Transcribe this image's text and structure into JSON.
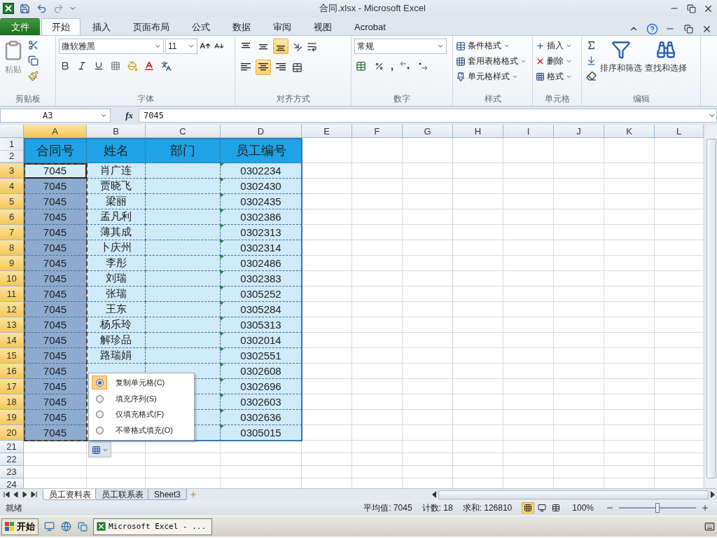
{
  "title": "合同.xlsx - Microsoft Excel",
  "ribbon_tabs": [
    {
      "label": "文件",
      "kind": "file",
      "selected": false
    },
    {
      "label": "开始",
      "kind": "tab",
      "selected": true
    },
    {
      "label": "插入",
      "kind": "tab",
      "selected": false
    },
    {
      "label": "页面布局",
      "kind": "tab",
      "selected": false
    },
    {
      "label": "公式",
      "kind": "tab",
      "selected": false
    },
    {
      "label": "数据",
      "kind": "tab",
      "selected": false
    },
    {
      "label": "审阅",
      "kind": "tab",
      "selected": false
    },
    {
      "label": "视图",
      "kind": "tab",
      "selected": false
    },
    {
      "label": "Acrobat",
      "kind": "tab",
      "selected": false
    }
  ],
  "clipboard": {
    "paste": "粘贴",
    "label": "剪贴板"
  },
  "font": {
    "name": "微软雅黑",
    "size": "11",
    "label": "字体"
  },
  "alignment": {
    "label": "对齐方式",
    "vertical": [
      {
        "selected": false
      },
      {
        "selected": false
      },
      {
        "selected": true
      }
    ],
    "horizontal": [
      {
        "selected": false
      },
      {
        "selected": true
      },
      {
        "selected": false
      }
    ]
  },
  "number": {
    "format": "常规",
    "comma": ",",
    "label": "数字"
  },
  "styles": {
    "items": [
      "条件格式",
      "套用表格格式",
      "单元格样式"
    ],
    "label": "样式"
  },
  "cells": {
    "items": [
      "插入",
      "删除",
      "格式"
    ],
    "label": "单元格"
  },
  "editing": {
    "items": [
      "排序和筛选",
      "查找和选择"
    ],
    "label": "编辑"
  },
  "formula_bar": {
    "name_box": "A3",
    "fx": "fx",
    "value": "7045"
  },
  "sheet": {
    "columns": [
      {
        "letter": "A",
        "selected": true
      },
      {
        "letter": "B",
        "selected": false
      },
      {
        "letter": "C",
        "selected": false
      },
      {
        "letter": "D",
        "selected": false
      },
      {
        "letter": "E",
        "selected": false
      },
      {
        "letter": "F",
        "selected": false
      },
      {
        "letter": "G",
        "selected": false
      },
      {
        "letter": "H",
        "selected": false
      },
      {
        "letter": "I",
        "selected": false
      },
      {
        "letter": "J",
        "selected": false
      },
      {
        "letter": "K",
        "selected": false
      },
      {
        "letter": "L",
        "selected": false
      }
    ],
    "header_rows": [
      {
        "number": "1",
        "selected": false
      },
      {
        "number": "2",
        "selected": false
      }
    ],
    "headers": [
      "合同号",
      "姓名",
      "部门",
      "员工编号"
    ],
    "id_error_flags": true,
    "rows": [
      {
        "number": "3",
        "selected": true,
        "active": true,
        "contract": "7045",
        "name": "肖广连",
        "employee_id": "0302234"
      },
      {
        "number": "4",
        "selected": true,
        "active": false,
        "contract": "7045",
        "name": "贾晓飞",
        "employee_id": "0302430"
      },
      {
        "number": "5",
        "selected": true,
        "active": false,
        "contract": "7045",
        "name": "梁丽",
        "employee_id": "0302435"
      },
      {
        "number": "6",
        "selected": true,
        "active": false,
        "contract": "7045",
        "name": "孟凡利",
        "employee_id": "0302386"
      },
      {
        "number": "7",
        "selected": true,
        "active": false,
        "contract": "7045",
        "name": "薄其成",
        "employee_id": "0302313"
      },
      {
        "number": "8",
        "selected": true,
        "active": false,
        "contract": "7045",
        "name": "卜庆州",
        "employee_id": "0302314"
      },
      {
        "number": "9",
        "selected": true,
        "active": false,
        "contract": "7045",
        "name": "李彤",
        "employee_id": "0302486"
      },
      {
        "number": "10",
        "selected": true,
        "active": false,
        "contract": "7045",
        "name": "刘瑞",
        "employee_id": "0302383"
      },
      {
        "number": "11",
        "selected": true,
        "active": false,
        "contract": "7045",
        "name": "张瑞",
        "employee_id": "0305252"
      },
      {
        "number": "12",
        "selected": true,
        "active": false,
        "contract": "7045",
        "name": "王东",
        "employee_id": "0305284"
      },
      {
        "number": "13",
        "selected": true,
        "active": false,
        "contract": "7045",
        "name": "杨乐玲",
        "employee_id": "0305313"
      },
      {
        "number": "14",
        "selected": true,
        "active": false,
        "contract": "7045",
        "name": "解珍品",
        "employee_id": "0302014"
      },
      {
        "number": "15",
        "selected": true,
        "active": false,
        "contract": "7045",
        "name": "路瑞娟",
        "employee_id": "0302551"
      },
      {
        "number": "16",
        "selected": true,
        "active": false,
        "contract": "7045",
        "employee_id": "0302608"
      },
      {
        "number": "17",
        "selected": true,
        "active": false,
        "contract": "7045",
        "employee_id": "0302696"
      },
      {
        "number": "18",
        "selected": true,
        "active": false,
        "contract": "7045",
        "employee_id": "0302603"
      },
      {
        "number": "19",
        "selected": true,
        "active": false,
        "contract": "7045",
        "employee_id": "0302636"
      },
      {
        "number": "20",
        "selected": true,
        "active": false,
        "contract": "7045",
        "employee_id": "0305015"
      },
      {
        "number": "21",
        "selected": false
      },
      {
        "number": "22",
        "selected": false
      },
      {
        "number": "23",
        "selected": false
      },
      {
        "number": "24",
        "selected": false
      }
    ]
  },
  "autofill_options": [
    {
      "label": "复制单元格(C)",
      "selected": true
    },
    {
      "label": "填充序列(S)",
      "selected": false
    },
    {
      "label": "仅填充格式(F)",
      "selected": false
    },
    {
      "label": "不带格式填充(O)",
      "selected": false
    }
  ],
  "sheet_tabs": [
    {
      "label": "员工资料表",
      "selected": true
    },
    {
      "label": "员工联系表",
      "selected": false
    },
    {
      "label": "Sheet3",
      "selected": false
    }
  ],
  "status_bar": {
    "ready": "就绪",
    "average": "平均值: 7045",
    "count": "计数: 18",
    "sum": "求和: 126810",
    "view_buttons": [
      {
        "kind": "normal",
        "selected": true
      },
      {
        "kind": "layout",
        "selected": false
      },
      {
        "kind": "break",
        "selected": false
      }
    ],
    "zoom": "100%",
    "zoom_slider": {
      "level": 0.5
    }
  },
  "taskbar": {
    "start": "开始",
    "tasks": [
      "Microsoft Excel - ..."
    ]
  }
}
